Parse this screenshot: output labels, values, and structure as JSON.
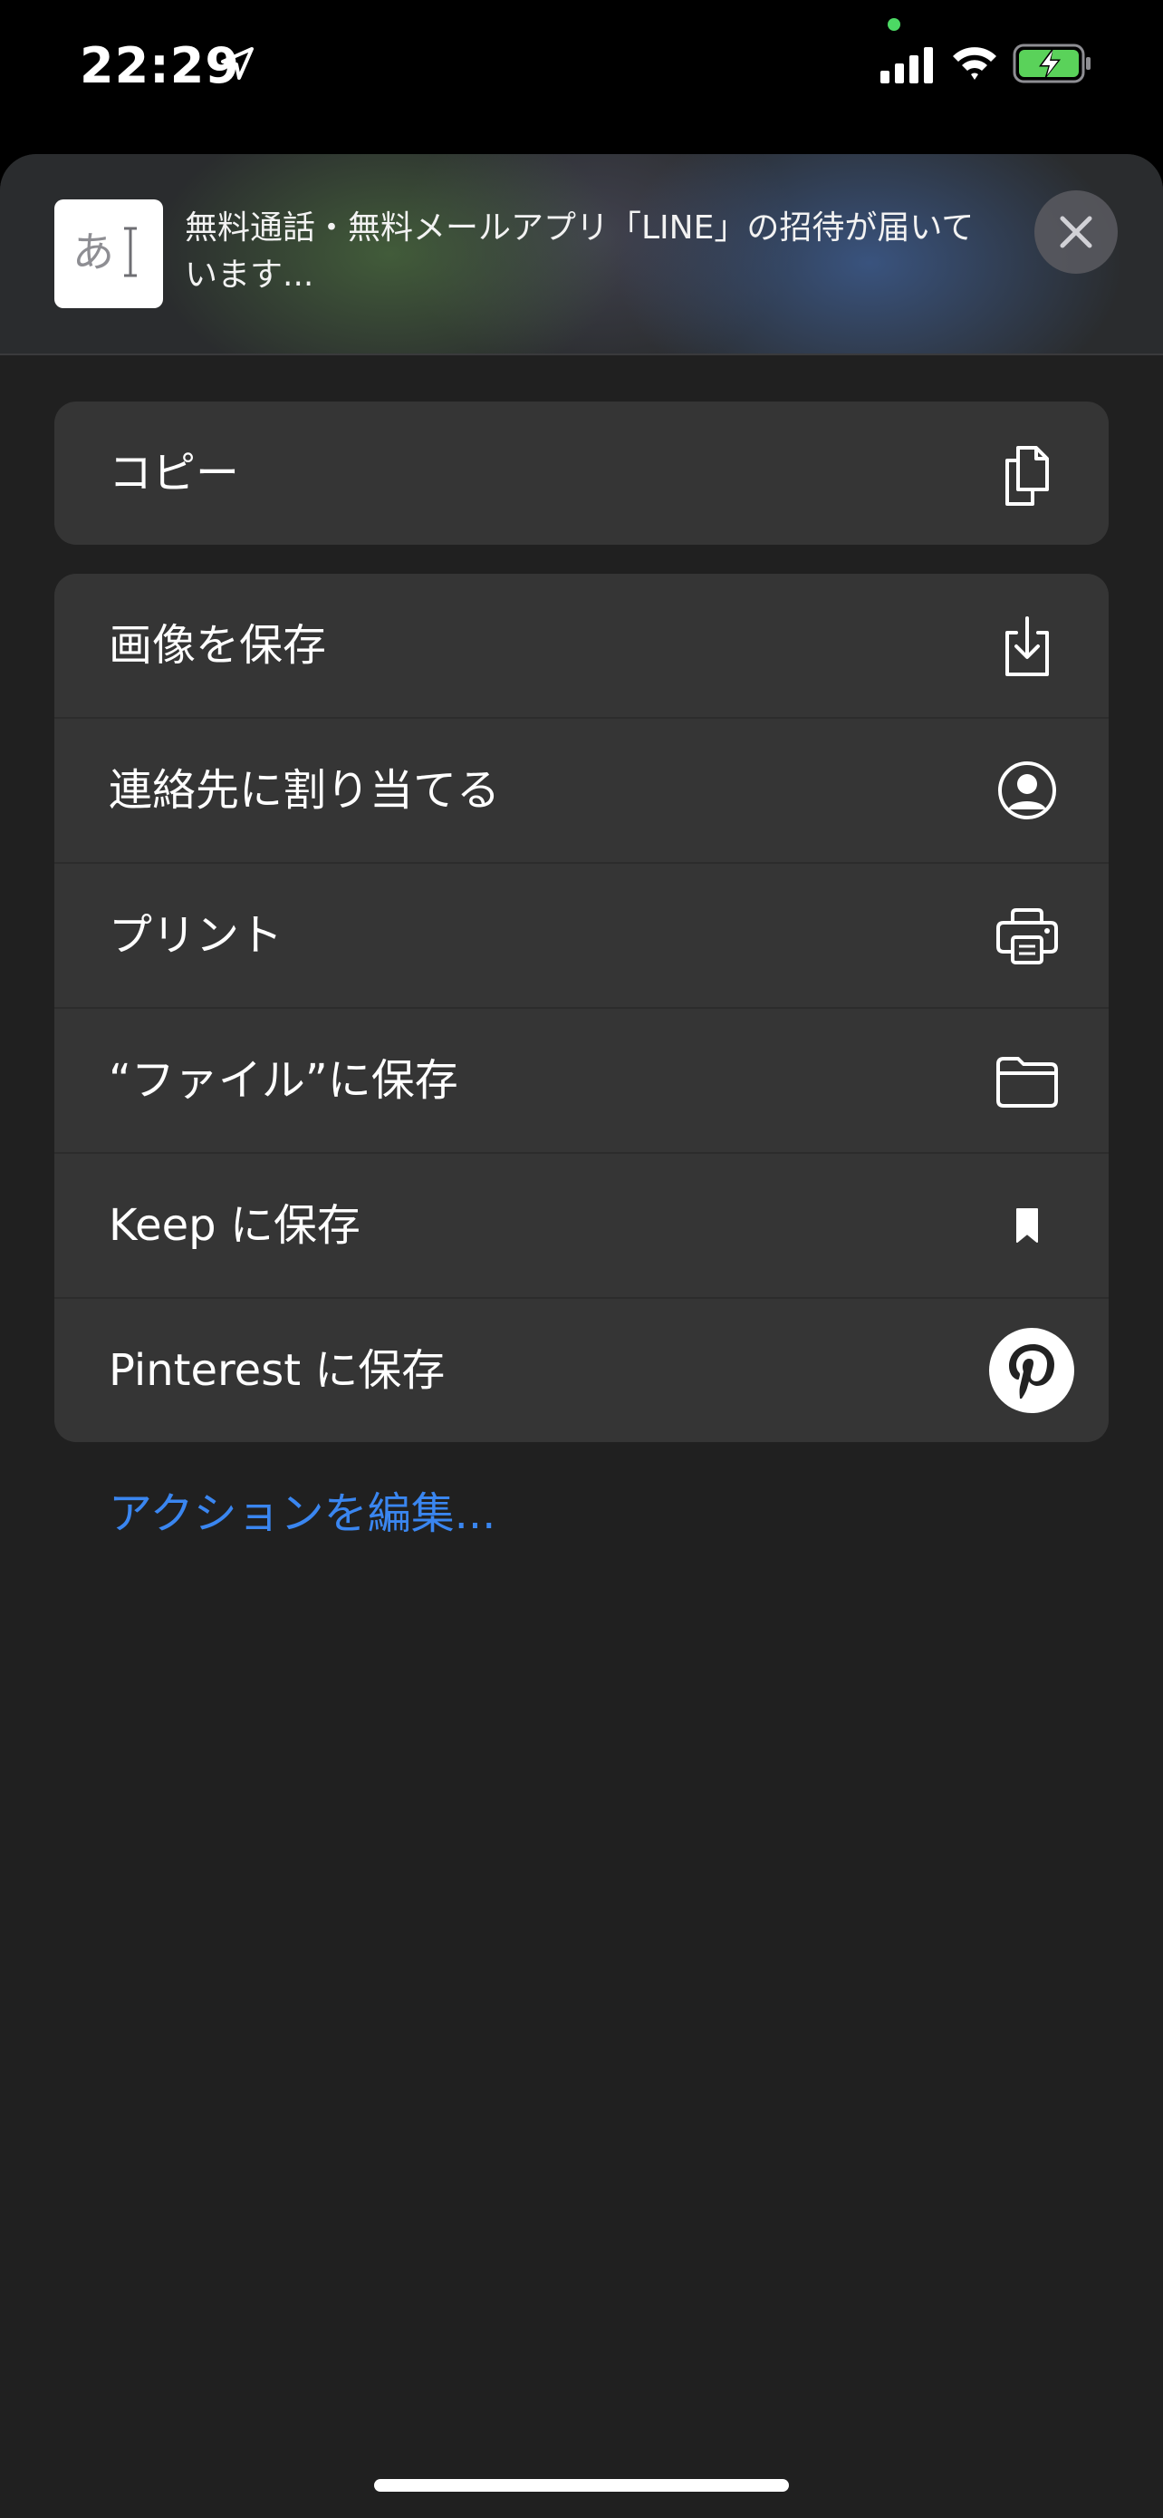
{
  "status_bar": {
    "time": "22:29",
    "camera_indicator_color": "#4cd964",
    "battery_color": "#5ad25a"
  },
  "share_sheet": {
    "preview": {
      "thumbnail_text": "あ",
      "title": "無料通話・無料メールアプリ「LINE」の招待が届いています..."
    },
    "close_label": "Close",
    "primary_group": [
      {
        "label": "コピー",
        "icon": "copy-icon"
      }
    ],
    "actions_group": [
      {
        "label": "画像を保存",
        "icon": "save-image-icon"
      },
      {
        "label": "連絡先に割り当てる",
        "icon": "contact-icon"
      },
      {
        "label": "プリント",
        "icon": "printer-icon"
      },
      {
        "label": "“ファイル”に保存",
        "icon": "folder-icon"
      },
      {
        "label": "Keep に保存",
        "icon": "bookmark-icon"
      },
      {
        "label": "Pinterest に保存",
        "icon": "pinterest-icon"
      }
    ],
    "edit_actions": "アクションを編集...",
    "link_color": "#3a86f0"
  }
}
